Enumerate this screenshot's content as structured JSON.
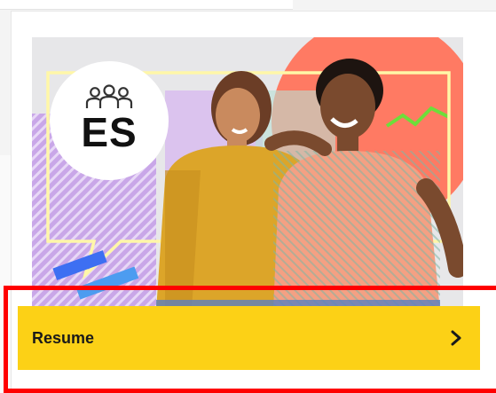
{
  "course_card": {
    "language_code": "ES",
    "badge_icon": "people-group-icon",
    "hero_image": "two-smiling-students-illustration",
    "resume_label": "Resume",
    "resume_icon": "chevron-right-icon"
  },
  "colors": {
    "accent_yellow": "#fcd116",
    "highlight_red": "#ff0000",
    "badge_bg": "#ffffff",
    "text_dark": "#1a1a1a"
  }
}
